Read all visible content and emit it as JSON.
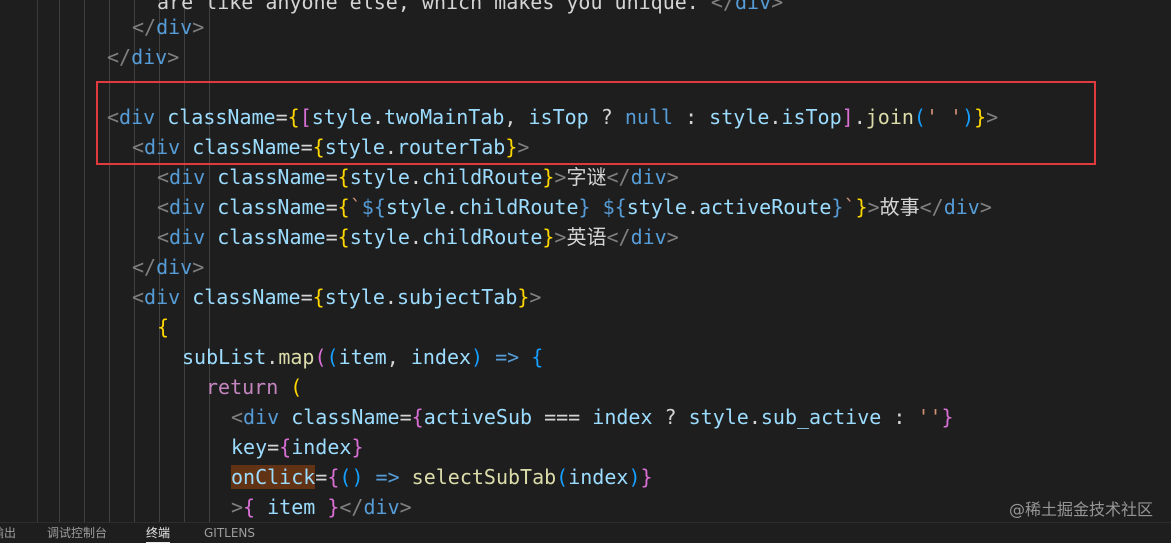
{
  "colors": {
    "background": "#1e1e1e",
    "highlight_border": "#e0393e"
  },
  "code": {
    "lines": [
      [
        {
          "t": "are like anyone else, which makes you unique.",
          "c": "text"
        },
        {
          "t": " </",
          "c": "punct"
        },
        {
          "t": "div",
          "c": "tag"
        },
        {
          "t": ">",
          "c": "punct"
        }
      ],
      [
        {
          "t": "</",
          "c": "punct"
        },
        {
          "t": "div",
          "c": "tag"
        },
        {
          "t": ">",
          "c": "punct"
        }
      ],
      [
        {
          "t": "</",
          "c": "punct"
        },
        {
          "t": "div",
          "c": "tag"
        },
        {
          "t": ">",
          "c": "punct"
        }
      ],
      [],
      [
        {
          "t": "<",
          "c": "punct"
        },
        {
          "t": "div",
          "c": "tag"
        },
        {
          "t": " ",
          "c": "text"
        },
        {
          "t": "className",
          "c": "attr"
        },
        {
          "t": "=",
          "c": "op"
        },
        {
          "t": "{",
          "c": "brace"
        },
        {
          "t": "[",
          "c": "brace2"
        },
        {
          "t": "style",
          "c": "var"
        },
        {
          "t": ".",
          "c": "op"
        },
        {
          "t": "twoMainTab",
          "c": "var"
        },
        {
          "t": ", ",
          "c": "op"
        },
        {
          "t": "isTop",
          "c": "var"
        },
        {
          "t": " ? ",
          "c": "op"
        },
        {
          "t": "null",
          "c": "kw"
        },
        {
          "t": " : ",
          "c": "op"
        },
        {
          "t": "style",
          "c": "var"
        },
        {
          "t": ".",
          "c": "op"
        },
        {
          "t": "isTop",
          "c": "var"
        },
        {
          "t": "]",
          "c": "brace2"
        },
        {
          "t": ".",
          "c": "op"
        },
        {
          "t": "join",
          "c": "fn"
        },
        {
          "t": "(",
          "c": "brace3"
        },
        {
          "t": "' '",
          "c": "str"
        },
        {
          "t": ")",
          "c": "brace3"
        },
        {
          "t": "}",
          "c": "brace"
        },
        {
          "t": ">",
          "c": "punct"
        }
      ],
      [
        {
          "t": "<",
          "c": "punct"
        },
        {
          "t": "div",
          "c": "tag"
        },
        {
          "t": " ",
          "c": "text"
        },
        {
          "t": "className",
          "c": "attr"
        },
        {
          "t": "=",
          "c": "op"
        },
        {
          "t": "{",
          "c": "brace"
        },
        {
          "t": "style",
          "c": "var"
        },
        {
          "t": ".",
          "c": "op"
        },
        {
          "t": "routerTab",
          "c": "var"
        },
        {
          "t": "}",
          "c": "brace"
        },
        {
          "t": ">",
          "c": "punct"
        }
      ],
      [
        {
          "t": "<",
          "c": "punct"
        },
        {
          "t": "div",
          "c": "tag"
        },
        {
          "t": " ",
          "c": "text"
        },
        {
          "t": "className",
          "c": "attr"
        },
        {
          "t": "=",
          "c": "op"
        },
        {
          "t": "{",
          "c": "brace"
        },
        {
          "t": "style",
          "c": "var"
        },
        {
          "t": ".",
          "c": "op"
        },
        {
          "t": "childRoute",
          "c": "var"
        },
        {
          "t": "}",
          "c": "brace"
        },
        {
          "t": ">",
          "c": "punct"
        },
        {
          "t": "字谜",
          "c": "text"
        },
        {
          "t": "</",
          "c": "punct"
        },
        {
          "t": "div",
          "c": "tag"
        },
        {
          "t": ">",
          "c": "punct"
        }
      ],
      [
        {
          "t": "<",
          "c": "punct"
        },
        {
          "t": "div",
          "c": "tag"
        },
        {
          "t": " ",
          "c": "text"
        },
        {
          "t": "className",
          "c": "attr"
        },
        {
          "t": "=",
          "c": "op"
        },
        {
          "t": "{",
          "c": "brace"
        },
        {
          "t": "`",
          "c": "str"
        },
        {
          "t": "${",
          "c": "kw"
        },
        {
          "t": "style",
          "c": "var"
        },
        {
          "t": ".",
          "c": "op"
        },
        {
          "t": "childRoute",
          "c": "var"
        },
        {
          "t": "}",
          "c": "kw"
        },
        {
          "t": " ",
          "c": "str"
        },
        {
          "t": "${",
          "c": "kw"
        },
        {
          "t": "style",
          "c": "var"
        },
        {
          "t": ".",
          "c": "op"
        },
        {
          "t": "activeRoute",
          "c": "var"
        },
        {
          "t": "}",
          "c": "kw"
        },
        {
          "t": "`",
          "c": "str"
        },
        {
          "t": "}",
          "c": "brace"
        },
        {
          "t": ">",
          "c": "punct"
        },
        {
          "t": "故事",
          "c": "text"
        },
        {
          "t": "</",
          "c": "punct"
        },
        {
          "t": "div",
          "c": "tag"
        },
        {
          "t": ">",
          "c": "punct"
        }
      ],
      [
        {
          "t": "<",
          "c": "punct"
        },
        {
          "t": "div",
          "c": "tag"
        },
        {
          "t": " ",
          "c": "text"
        },
        {
          "t": "className",
          "c": "attr"
        },
        {
          "t": "=",
          "c": "op"
        },
        {
          "t": "{",
          "c": "brace"
        },
        {
          "t": "style",
          "c": "var"
        },
        {
          "t": ".",
          "c": "op"
        },
        {
          "t": "childRoute",
          "c": "var"
        },
        {
          "t": "}",
          "c": "brace"
        },
        {
          "t": ">",
          "c": "punct"
        },
        {
          "t": "英语",
          "c": "text"
        },
        {
          "t": "</",
          "c": "punct"
        },
        {
          "t": "div",
          "c": "tag"
        },
        {
          "t": ">",
          "c": "punct"
        }
      ],
      [
        {
          "t": "</",
          "c": "punct"
        },
        {
          "t": "div",
          "c": "tag"
        },
        {
          "t": ">",
          "c": "punct"
        }
      ],
      [
        {
          "t": "<",
          "c": "punct"
        },
        {
          "t": "div",
          "c": "tag"
        },
        {
          "t": " ",
          "c": "text"
        },
        {
          "t": "className",
          "c": "attr"
        },
        {
          "t": "=",
          "c": "op"
        },
        {
          "t": "{",
          "c": "brace"
        },
        {
          "t": "style",
          "c": "var"
        },
        {
          "t": ".",
          "c": "op"
        },
        {
          "t": "subjectTab",
          "c": "var"
        },
        {
          "t": "}",
          "c": "brace"
        },
        {
          "t": ">",
          "c": "punct"
        }
      ],
      [
        {
          "t": "{",
          "c": "brace"
        }
      ],
      [
        {
          "t": "subList",
          "c": "var"
        },
        {
          "t": ".",
          "c": "op"
        },
        {
          "t": "map",
          "c": "fn"
        },
        {
          "t": "(",
          "c": "brace2"
        },
        {
          "t": "(",
          "c": "brace3"
        },
        {
          "t": "item",
          "c": "var"
        },
        {
          "t": ", ",
          "c": "op"
        },
        {
          "t": "index",
          "c": "var"
        },
        {
          "t": ")",
          "c": "brace3"
        },
        {
          "t": " ",
          "c": "op"
        },
        {
          "t": "=>",
          "c": "kw"
        },
        {
          "t": " ",
          "c": "op"
        },
        {
          "t": "{",
          "c": "brace3"
        }
      ],
      [
        {
          "t": "return",
          "c": "kw2"
        },
        {
          "t": " ",
          "c": "op"
        },
        {
          "t": "(",
          "c": "brace"
        }
      ],
      [
        {
          "t": "<",
          "c": "punct"
        },
        {
          "t": "div",
          "c": "tag"
        },
        {
          "t": " ",
          "c": "text"
        },
        {
          "t": "className",
          "c": "attr"
        },
        {
          "t": "=",
          "c": "op"
        },
        {
          "t": "{",
          "c": "brace2"
        },
        {
          "t": "activeSub",
          "c": "var"
        },
        {
          "t": " === ",
          "c": "op"
        },
        {
          "t": "index",
          "c": "var"
        },
        {
          "t": " ? ",
          "c": "op"
        },
        {
          "t": "style",
          "c": "var"
        },
        {
          "t": ".",
          "c": "op"
        },
        {
          "t": "sub_active",
          "c": "var"
        },
        {
          "t": " : ",
          "c": "op"
        },
        {
          "t": "''",
          "c": "str"
        },
        {
          "t": "}",
          "c": "brace2"
        }
      ],
      [
        {
          "t": "key",
          "c": "attr"
        },
        {
          "t": "=",
          "c": "op"
        },
        {
          "t": "{",
          "c": "brace2"
        },
        {
          "t": "index",
          "c": "var"
        },
        {
          "t": "}",
          "c": "brace2"
        }
      ],
      [
        {
          "t": "onClick",
          "c": "attr",
          "hl": true
        },
        {
          "t": "=",
          "c": "op"
        },
        {
          "t": "{",
          "c": "brace2"
        },
        {
          "t": "(",
          "c": "brace3"
        },
        {
          "t": ")",
          "c": "brace3"
        },
        {
          "t": " ",
          "c": "op"
        },
        {
          "t": "=>",
          "c": "kw"
        },
        {
          "t": " ",
          "c": "op"
        },
        {
          "t": "selectSubTab",
          "c": "fn"
        },
        {
          "t": "(",
          "c": "brace3"
        },
        {
          "t": "index",
          "c": "var"
        },
        {
          "t": ")",
          "c": "brace3"
        },
        {
          "t": "}",
          "c": "brace2"
        }
      ],
      [
        {
          "t": ">",
          "c": "punct"
        },
        {
          "t": "{",
          "c": "brace2"
        },
        {
          "t": " item ",
          "c": "var"
        },
        {
          "t": "}",
          "c": "brace2"
        },
        {
          "t": "</",
          "c": "punct"
        },
        {
          "t": "div",
          "c": "tag"
        },
        {
          "t": ">",
          "c": "punct"
        }
      ]
    ]
  },
  "panel": {
    "tabs": [
      "输出",
      "调试控制台",
      "终端",
      "GITLENS"
    ],
    "active_tab": "终端"
  },
  "watermark": "@稀土掘金技术社区"
}
